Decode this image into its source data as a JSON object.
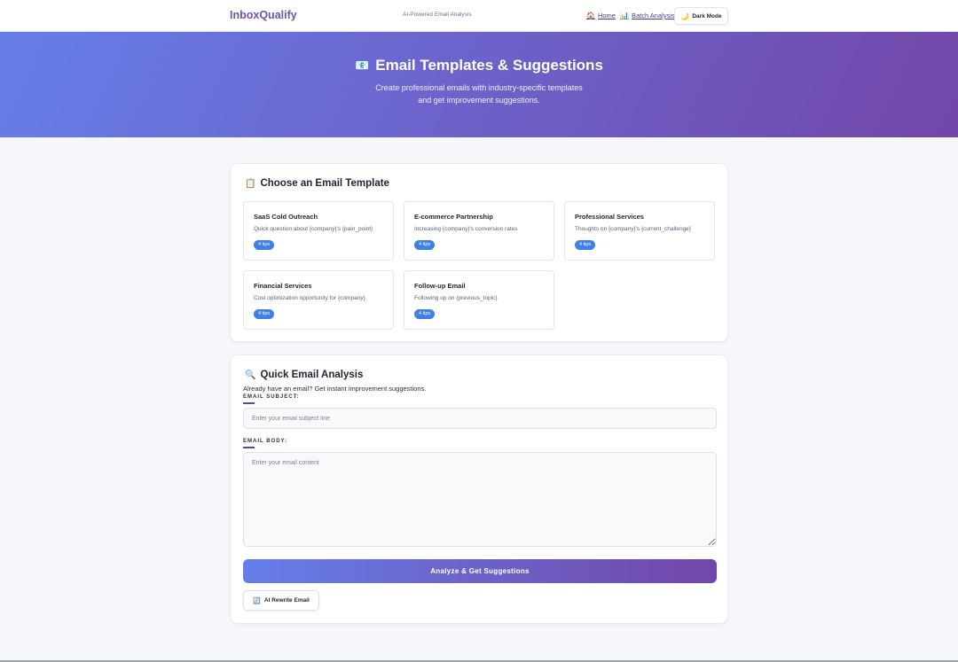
{
  "nav": {
    "brand": "InboxQualify",
    "tagline": "AI-Powered Email Analysis",
    "links": [
      {
        "icon": "🏠",
        "label": "Home"
      },
      {
        "icon": "📊",
        "label": "Batch Analysis"
      }
    ],
    "dark_mode": {
      "icon": "🌙",
      "label": "Dark Mode"
    }
  },
  "hero": {
    "icon": "📧",
    "title": "Email Templates & Suggestions",
    "subtitle_line1": "Create professional emails with industry-specific templates",
    "subtitle_line2": "and get improvement suggestions."
  },
  "templates_section": {
    "icon": "📋",
    "title": "Choose an Email Template",
    "items": [
      {
        "name": "SaaS Cold Outreach",
        "subject": "Quick question about {company}'s {pain_point}",
        "badge": "4 tips"
      },
      {
        "name": "E-commerce Partnership",
        "subject": "Increasing {company}'s conversion rates",
        "badge": "4 tips"
      },
      {
        "name": "Professional Services",
        "subject": "Thoughts on {company}'s {current_challenge}",
        "badge": "4 tips"
      },
      {
        "name": "Financial Services",
        "subject": "Cost optimization opportunity for {company}",
        "badge": "4 tips"
      },
      {
        "name": "Follow-up Email",
        "subject": "Following up on {previous_topic}",
        "badge": "4 tips"
      }
    ]
  },
  "analysis_section": {
    "icon": "🔍",
    "title": "Quick Email Analysis",
    "intro": "Already have an email? Get instant improvement suggestions.",
    "subject_label": "EMAIL SUBJECT:",
    "subject_placeholder": "Enter your email subject line",
    "body_label": "EMAIL BODY:",
    "body_placeholder": "Enter your email content",
    "analyze_label": "Analyze & Get Suggestions",
    "rewrite": {
      "icon": "🔄",
      "label": "AI Rewrite Email"
    }
  },
  "colors": {
    "brand": "#6a55b5",
    "gradient_start": "#667eea",
    "gradient_end": "#7246a8",
    "badge": "#3f7fe6"
  }
}
